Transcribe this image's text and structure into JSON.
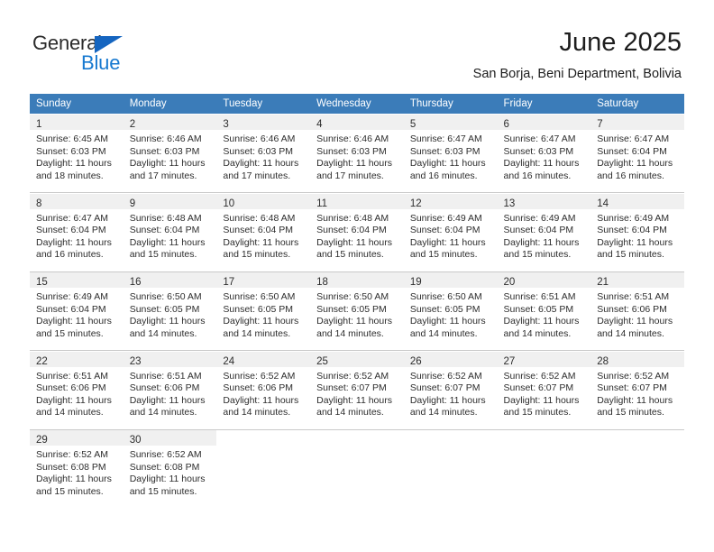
{
  "brand": {
    "name_top": "General",
    "name_bottom": "Blue",
    "accent_color": "#1779d0",
    "triangle_color": "#1565c0"
  },
  "header": {
    "month_title": "June 2025",
    "location": "San Borja, Beni Department, Bolivia"
  },
  "calendar": {
    "header_bg": "#3b7cb9",
    "header_text_color": "#ffffff",
    "daynum_band_bg": "#f0f0f0",
    "weekdays": [
      "Sunday",
      "Monday",
      "Tuesday",
      "Wednesday",
      "Thursday",
      "Friday",
      "Saturday"
    ],
    "weeks": [
      [
        {
          "day": "1",
          "sunrise": "Sunrise: 6:45 AM",
          "sunset": "Sunset: 6:03 PM",
          "daylight1": "Daylight: 11 hours",
          "daylight2": "and 18 minutes."
        },
        {
          "day": "2",
          "sunrise": "Sunrise: 6:46 AM",
          "sunset": "Sunset: 6:03 PM",
          "daylight1": "Daylight: 11 hours",
          "daylight2": "and 17 minutes."
        },
        {
          "day": "3",
          "sunrise": "Sunrise: 6:46 AM",
          "sunset": "Sunset: 6:03 PM",
          "daylight1": "Daylight: 11 hours",
          "daylight2": "and 17 minutes."
        },
        {
          "day": "4",
          "sunrise": "Sunrise: 6:46 AM",
          "sunset": "Sunset: 6:03 PM",
          "daylight1": "Daylight: 11 hours",
          "daylight2": "and 17 minutes."
        },
        {
          "day": "5",
          "sunrise": "Sunrise: 6:47 AM",
          "sunset": "Sunset: 6:03 PM",
          "daylight1": "Daylight: 11 hours",
          "daylight2": "and 16 minutes."
        },
        {
          "day": "6",
          "sunrise": "Sunrise: 6:47 AM",
          "sunset": "Sunset: 6:03 PM",
          "daylight1": "Daylight: 11 hours",
          "daylight2": "and 16 minutes."
        },
        {
          "day": "7",
          "sunrise": "Sunrise: 6:47 AM",
          "sunset": "Sunset: 6:04 PM",
          "daylight1": "Daylight: 11 hours",
          "daylight2": "and 16 minutes."
        }
      ],
      [
        {
          "day": "8",
          "sunrise": "Sunrise: 6:47 AM",
          "sunset": "Sunset: 6:04 PM",
          "daylight1": "Daylight: 11 hours",
          "daylight2": "and 16 minutes."
        },
        {
          "day": "9",
          "sunrise": "Sunrise: 6:48 AM",
          "sunset": "Sunset: 6:04 PM",
          "daylight1": "Daylight: 11 hours",
          "daylight2": "and 15 minutes."
        },
        {
          "day": "10",
          "sunrise": "Sunrise: 6:48 AM",
          "sunset": "Sunset: 6:04 PM",
          "daylight1": "Daylight: 11 hours",
          "daylight2": "and 15 minutes."
        },
        {
          "day": "11",
          "sunrise": "Sunrise: 6:48 AM",
          "sunset": "Sunset: 6:04 PM",
          "daylight1": "Daylight: 11 hours",
          "daylight2": "and 15 minutes."
        },
        {
          "day": "12",
          "sunrise": "Sunrise: 6:49 AM",
          "sunset": "Sunset: 6:04 PM",
          "daylight1": "Daylight: 11 hours",
          "daylight2": "and 15 minutes."
        },
        {
          "day": "13",
          "sunrise": "Sunrise: 6:49 AM",
          "sunset": "Sunset: 6:04 PM",
          "daylight1": "Daylight: 11 hours",
          "daylight2": "and 15 minutes."
        },
        {
          "day": "14",
          "sunrise": "Sunrise: 6:49 AM",
          "sunset": "Sunset: 6:04 PM",
          "daylight1": "Daylight: 11 hours",
          "daylight2": "and 15 minutes."
        }
      ],
      [
        {
          "day": "15",
          "sunrise": "Sunrise: 6:49 AM",
          "sunset": "Sunset: 6:04 PM",
          "daylight1": "Daylight: 11 hours",
          "daylight2": "and 15 minutes."
        },
        {
          "day": "16",
          "sunrise": "Sunrise: 6:50 AM",
          "sunset": "Sunset: 6:05 PM",
          "daylight1": "Daylight: 11 hours",
          "daylight2": "and 14 minutes."
        },
        {
          "day": "17",
          "sunrise": "Sunrise: 6:50 AM",
          "sunset": "Sunset: 6:05 PM",
          "daylight1": "Daylight: 11 hours",
          "daylight2": "and 14 minutes."
        },
        {
          "day": "18",
          "sunrise": "Sunrise: 6:50 AM",
          "sunset": "Sunset: 6:05 PM",
          "daylight1": "Daylight: 11 hours",
          "daylight2": "and 14 minutes."
        },
        {
          "day": "19",
          "sunrise": "Sunrise: 6:50 AM",
          "sunset": "Sunset: 6:05 PM",
          "daylight1": "Daylight: 11 hours",
          "daylight2": "and 14 minutes."
        },
        {
          "day": "20",
          "sunrise": "Sunrise: 6:51 AM",
          "sunset": "Sunset: 6:05 PM",
          "daylight1": "Daylight: 11 hours",
          "daylight2": "and 14 minutes."
        },
        {
          "day": "21",
          "sunrise": "Sunrise: 6:51 AM",
          "sunset": "Sunset: 6:06 PM",
          "daylight1": "Daylight: 11 hours",
          "daylight2": "and 14 minutes."
        }
      ],
      [
        {
          "day": "22",
          "sunrise": "Sunrise: 6:51 AM",
          "sunset": "Sunset: 6:06 PM",
          "daylight1": "Daylight: 11 hours",
          "daylight2": "and 14 minutes."
        },
        {
          "day": "23",
          "sunrise": "Sunrise: 6:51 AM",
          "sunset": "Sunset: 6:06 PM",
          "daylight1": "Daylight: 11 hours",
          "daylight2": "and 14 minutes."
        },
        {
          "day": "24",
          "sunrise": "Sunrise: 6:52 AM",
          "sunset": "Sunset: 6:06 PM",
          "daylight1": "Daylight: 11 hours",
          "daylight2": "and 14 minutes."
        },
        {
          "day": "25",
          "sunrise": "Sunrise: 6:52 AM",
          "sunset": "Sunset: 6:07 PM",
          "daylight1": "Daylight: 11 hours",
          "daylight2": "and 14 minutes."
        },
        {
          "day": "26",
          "sunrise": "Sunrise: 6:52 AM",
          "sunset": "Sunset: 6:07 PM",
          "daylight1": "Daylight: 11 hours",
          "daylight2": "and 14 minutes."
        },
        {
          "day": "27",
          "sunrise": "Sunrise: 6:52 AM",
          "sunset": "Sunset: 6:07 PM",
          "daylight1": "Daylight: 11 hours",
          "daylight2": "and 15 minutes."
        },
        {
          "day": "28",
          "sunrise": "Sunrise: 6:52 AM",
          "sunset": "Sunset: 6:07 PM",
          "daylight1": "Daylight: 11 hours",
          "daylight2": "and 15 minutes."
        }
      ],
      [
        {
          "day": "29",
          "sunrise": "Sunrise: 6:52 AM",
          "sunset": "Sunset: 6:08 PM",
          "daylight1": "Daylight: 11 hours",
          "daylight2": "and 15 minutes."
        },
        {
          "day": "30",
          "sunrise": "Sunrise: 6:52 AM",
          "sunset": "Sunset: 6:08 PM",
          "daylight1": "Daylight: 11 hours",
          "daylight2": "and 15 minutes."
        },
        {
          "day": "",
          "sunrise": "",
          "sunset": "",
          "daylight1": "",
          "daylight2": ""
        },
        {
          "day": "",
          "sunrise": "",
          "sunset": "",
          "daylight1": "",
          "daylight2": ""
        },
        {
          "day": "",
          "sunrise": "",
          "sunset": "",
          "daylight1": "",
          "daylight2": ""
        },
        {
          "day": "",
          "sunrise": "",
          "sunset": "",
          "daylight1": "",
          "daylight2": ""
        },
        {
          "day": "",
          "sunrise": "",
          "sunset": "",
          "daylight1": "",
          "daylight2": ""
        }
      ]
    ]
  }
}
